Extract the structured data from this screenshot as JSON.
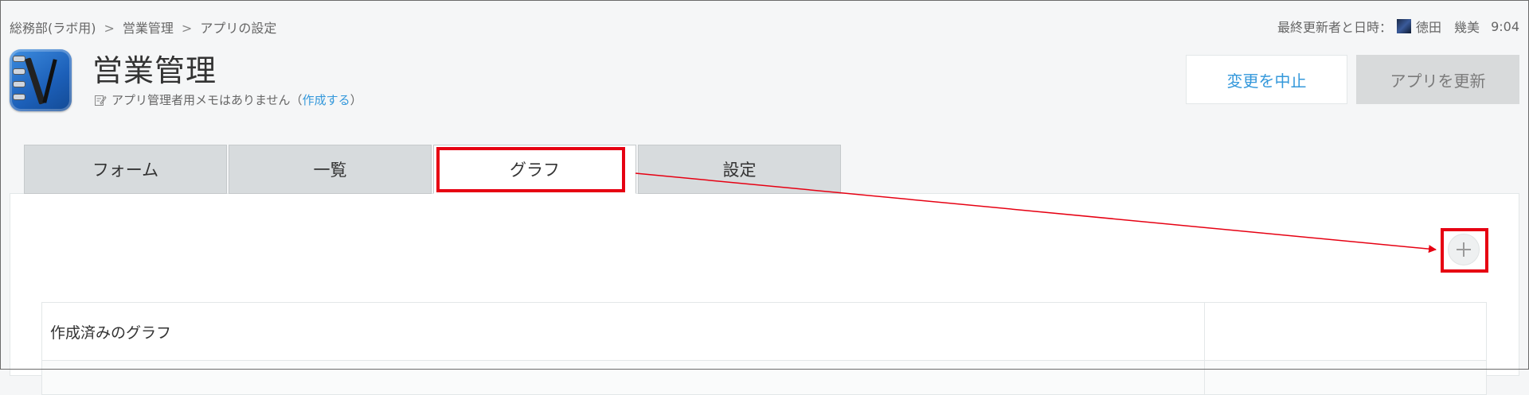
{
  "breadcrumb": {
    "items": [
      "総務部(ラボ用)",
      "営業管理",
      "アプリの設定"
    ],
    "separator": ">"
  },
  "updated": {
    "label": "最終更新者と日時：",
    "user": "徳田　幾美",
    "time": "9:04"
  },
  "app": {
    "title": "営業管理",
    "memo_text": "アプリ管理者用メモはありません（",
    "memo_link": "作成する",
    "memo_close": "）"
  },
  "buttons": {
    "cancel": "変更を中止",
    "update": "アプリを更新"
  },
  "tabs": [
    {
      "label": "フォーム",
      "active": false
    },
    {
      "label": "一覧",
      "active": false
    },
    {
      "label": "グラフ",
      "active": true
    },
    {
      "label": "設定",
      "active": false
    }
  ],
  "panel": {
    "add_icon": "plus-icon",
    "table_header": "作成済みのグラフ"
  },
  "colors": {
    "accent": "#3498db",
    "annotation": "#e60012",
    "tab_bg": "#d7dbdd",
    "update_button_bg": "#d8dadb"
  }
}
